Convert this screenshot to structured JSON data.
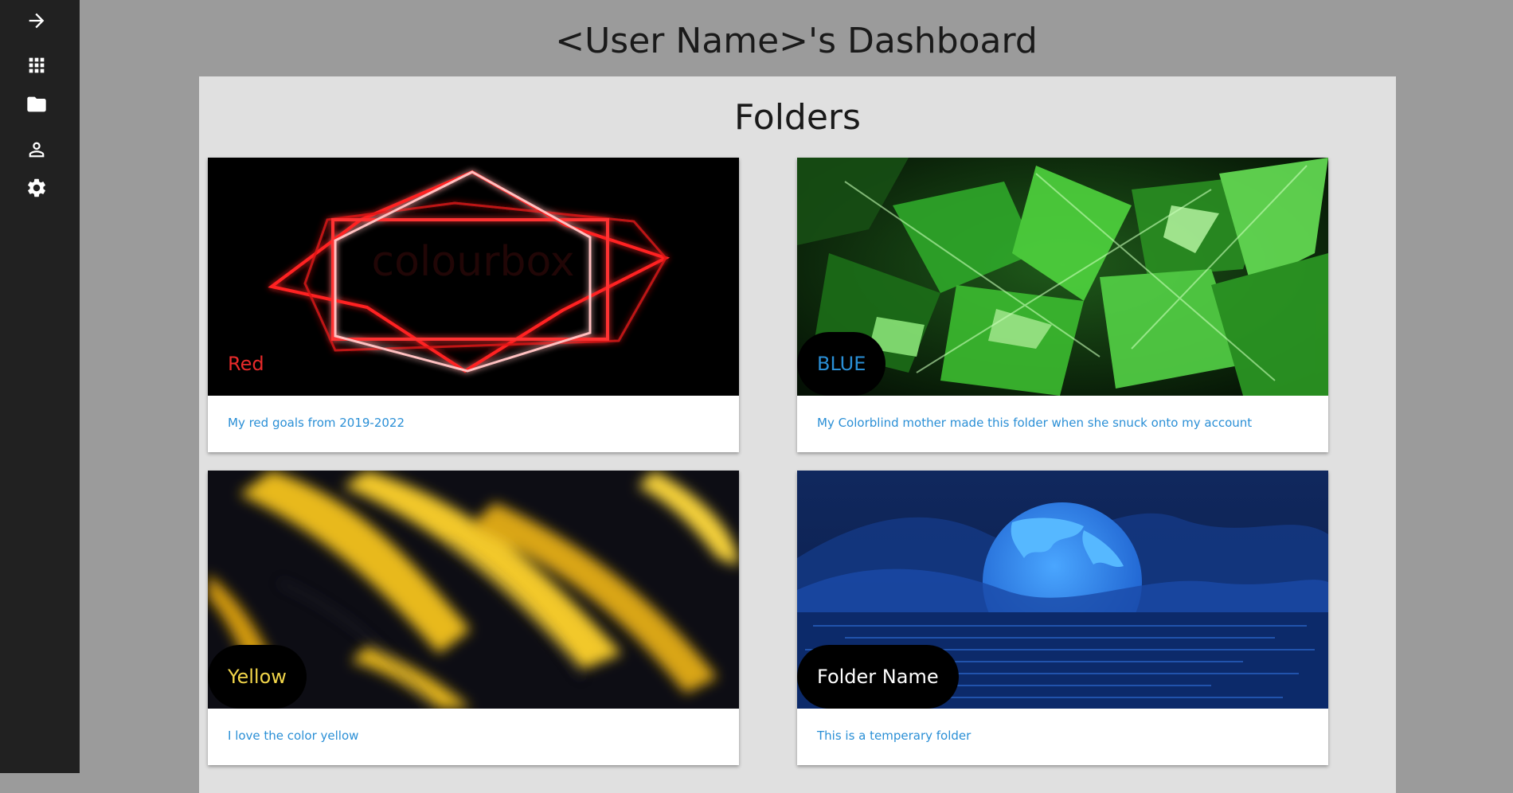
{
  "sidebar": {
    "items": [
      {
        "icon": "arrow-right-icon",
        "label": "Expand"
      },
      {
        "icon": "apps-grid-icon",
        "label": "Apps"
      },
      {
        "icon": "folder-icon",
        "label": "Folders"
      },
      {
        "icon": "user-icon",
        "label": "Profile"
      },
      {
        "icon": "gear-icon",
        "label": "Settings"
      }
    ]
  },
  "header": {
    "title": "<User Name>'s Dashboard"
  },
  "folders_panel": {
    "title": "Folders",
    "cards": [
      {
        "name": "Red",
        "name_color": "#e82a2a",
        "description": "My red goals from 2019-2022",
        "theme": "red-neon-hexagon"
      },
      {
        "name": "BLUE",
        "name_color": "#2a8fd6",
        "description": "My Colorblind mother made this folder when she snuck onto my account",
        "theme": "green-crystals"
      },
      {
        "name": "Yellow",
        "name_color": "#f2d64a",
        "description": "I love the color yellow",
        "theme": "yellow-black-abstract"
      },
      {
        "name": "Folder Name",
        "name_color": "#ffffff",
        "description": "This is a temperary folder",
        "theme": "blue-moon-night"
      }
    ]
  },
  "colors": {
    "sidebar_bg": "#212121",
    "page_bg": "#9b9b9b",
    "panel_bg": "#e0e0e0",
    "link_blue": "#2a8fd6"
  }
}
